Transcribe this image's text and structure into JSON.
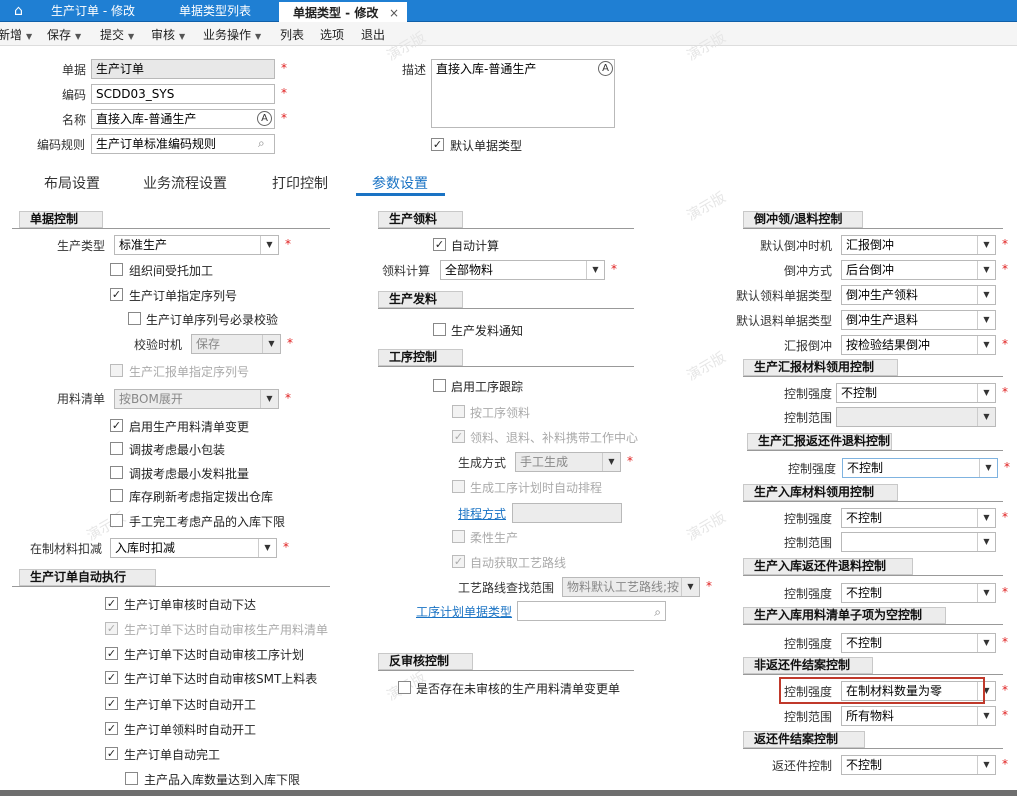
{
  "tabs": {
    "t1": "生产订单 - 修改",
    "t2": "单据类型列表",
    "t3": "单据类型 - 修改",
    "close": "×"
  },
  "toolbar": {
    "new": "新增",
    "save": "保存",
    "submit": "提交",
    "audit": "审核",
    "bizop": "业务操作",
    "list": "列表",
    "options": "选项",
    "exit": "退出",
    "caret": "▼"
  },
  "header": {
    "doc_label": "单据",
    "doc_value": "生产订单",
    "code_label": "编码",
    "code_value": "SCDD03_SYS",
    "name_label": "名称",
    "name_value": "直接入库-普通生产",
    "rule_label": "编码规则",
    "rule_value": "生产订单标准编码规则",
    "desc_label": "描述",
    "desc_value": "直接入库-普通生产",
    "default_label": "默认单据类型"
  },
  "ptabs": {
    "layout": "布局设置",
    "flow": "业务流程设置",
    "print": "打印控制",
    "param": "参数设置"
  },
  "left": {
    "sec1": "单据控制",
    "prod_type_label": "生产类型",
    "prod_type_value": "标准生产",
    "c1": "组织间受托加工",
    "c2": "生产订单指定序列号",
    "c3": "生产订单序列号必录校验",
    "check_time_label": "校验时机",
    "check_time_value": "保存",
    "c4": "生产汇报单指定序列号",
    "bom_label": "用料清单",
    "bom_value": "按BOM展开",
    "c5": "启用生产用料清单变更",
    "c6": "调拔考虑最小包装",
    "c7": "调拔考虑最小发料批量",
    "c8": "库存刷新考虑指定拨出仓库",
    "c9": "手工完工考虑产品的入库下限",
    "wip_label": "在制材料扣减",
    "wip_value": "入库时扣减",
    "sec2": "生产订单自动执行",
    "d1": "生产订单审核时自动下达",
    "d2": "生产订单下达时自动审核生产用料清单",
    "d3": "生产订单下达时自动审核工序计划",
    "d4": "生产订单下达时自动审核SMT上料表",
    "d5": "生产订单下达时自动开工",
    "d6": "生产订单领料时自动开工",
    "d7": "生产订单自动完工",
    "d8": "主产品入库数量达到入库下限"
  },
  "mid": {
    "sec1": "生产领料",
    "auto_calc": "自动计算",
    "pick_calc_label": "领料计算",
    "pick_calc_value": "全部物料",
    "sec2": "生产发料",
    "issue_notice": "生产发料通知",
    "sec3": "工序控制",
    "enable_route": "启用工序跟踪",
    "by_op_pick": "按工序领料",
    "carry": "领料、退料、补料携带工作中心",
    "gen_mode_label": "生成方式",
    "gen_mode_value": "手工生成",
    "auto_sched": "生成工序计划时自动排程",
    "sched_mode": "排程方式",
    "flex": "柔性生产",
    "auto_route": "自动获取工艺路线",
    "route_scope_label": "工艺路线查找范围",
    "route_scope_value": "物料默认工艺路线;按",
    "op_plan_type": "工序计划单据类型",
    "sec4": "反审核控制",
    "unaudited": "是否存在未审核的生产用料清单变更单"
  },
  "right": {
    "sec1": "倒冲领/退料控制",
    "r1l": "默认倒冲时机",
    "r1v": "汇报倒冲",
    "r2l": "倒冲方式",
    "r2v": "后台倒冲",
    "r3l": "默认领料单据类型",
    "r3v": "倒冲生产领料",
    "r4l": "默认退料单据类型",
    "r4v": "倒冲生产退料",
    "r5l": "汇报倒冲",
    "r5v": "按检验结果倒冲",
    "sec2": "生产汇报材料领用控制",
    "s2a_l": "控制强度",
    "s2a_v": "不控制",
    "s2b_l": "控制范围",
    "sec3": "生产汇报返还件退料控制",
    "s3a_l": "控制强度",
    "s3a_v": "不控制",
    "sec4": "生产入库材料领用控制",
    "s4a_l": "控制强度",
    "s4a_v": "不控制",
    "s4b_l": "控制范围",
    "sec5": "生产入库返还件退料控制",
    "s5a_l": "控制强度",
    "s5a_v": "不控制",
    "sec6": "生产入库用料清单子项为空控制",
    "s6a_l": "控制强度",
    "s6a_v": "不控制",
    "sec7": "非返还件结案控制",
    "s7a_l": "控制强度",
    "s7a_v": "在制材料数量为零",
    "s7b_l": "控制范围",
    "s7b_v": "所有物料",
    "sec8": "返还件结案控制",
    "s8a_l": "返还件控制",
    "s8a_v": "不控制"
  },
  "watermark": "演示版",
  "glyphs": {
    "home": "⌂",
    "star": "*",
    "check": "✓",
    "arrow": "▼",
    "search": "⌕",
    "a": "A"
  }
}
